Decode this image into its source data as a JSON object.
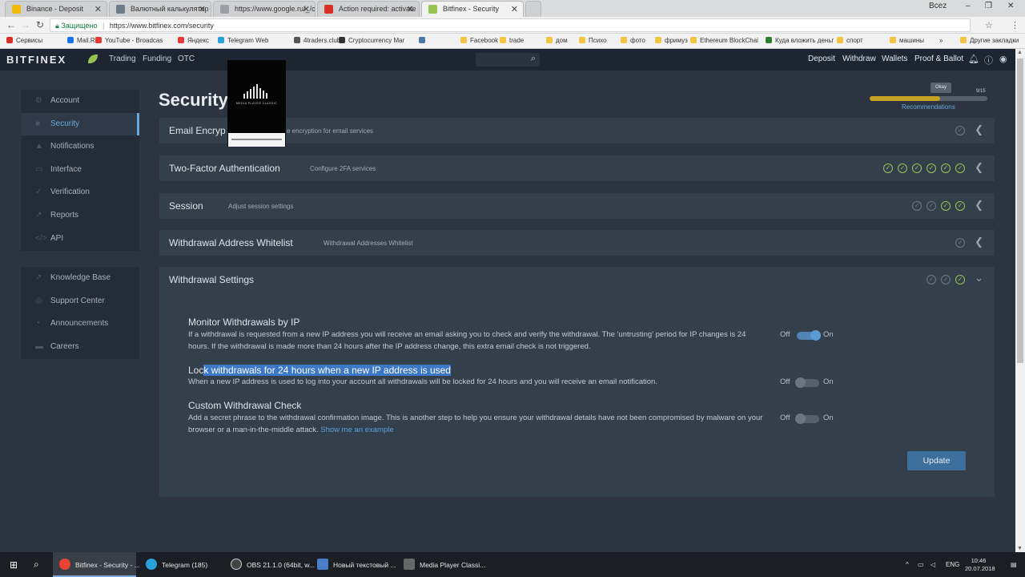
{
  "browser": {
    "tabs": [
      {
        "title": "Binance - Deposit",
        "color": "#f0b90b"
      },
      {
        "title": "Валютный калькулятор",
        "color": "#6d7b8a"
      },
      {
        "title": "https://www.google.ru/_/chro",
        "color": "#9aa0a6"
      },
      {
        "title": "Action required: activate",
        "color": "#d93025"
      },
      {
        "title": "Bitfinex - Security",
        "color": "#97c554"
      }
    ],
    "user_badge": "Всеz",
    "minimize": "–",
    "restore": "❐",
    "close": "✕",
    "secure_label": "Защищено",
    "url": "https://www.bitfinex.com/security",
    "bookmarks": [
      {
        "label": "Сервисы",
        "color": "#d93025"
      },
      {
        "label": "Mail.Ru",
        "color": "#1a73e8"
      },
      {
        "label": "YouTube - Broadcas",
        "color": "#e53935"
      },
      {
        "label": "Яндекс",
        "color": "#e53935"
      },
      {
        "label": "Telegram Web",
        "color": "#2aa1da"
      },
      {
        "label": "4traders.club",
        "color": "#555555"
      },
      {
        "label": "Cryptocurrency Mar",
        "color": "#333333"
      },
      {
        "label": "",
        "color": "#4a76a8"
      },
      {
        "label": "Facebook",
        "color": "#f4c542"
      },
      {
        "label": "trade",
        "color": "#f4c542"
      },
      {
        "label": "дом",
        "color": "#f4c542"
      },
      {
        "label": "Психо",
        "color": "#f4c542"
      },
      {
        "label": "фото",
        "color": "#f4c542"
      },
      {
        "label": "фримуз",
        "color": "#f4c542"
      },
      {
        "label": "Ethereum BlockChai",
        "color": "#f4c542"
      },
      {
        "label": "Куда вложить деньг",
        "color": "#2e7d32"
      },
      {
        "label": "спорт",
        "color": "#f4c542"
      },
      {
        "label": "машины",
        "color": "#f4c542"
      },
      {
        "label": "»",
        "color": ""
      },
      {
        "label": "Другие закладки",
        "color": "#f4c542"
      }
    ]
  },
  "header": {
    "logo": "BITFINEX",
    "nav": [
      "Trading",
      "Funding",
      "OTC"
    ],
    "right": [
      "Deposit",
      "Withdraw",
      "Wallets",
      "Proof & Ballot"
    ]
  },
  "sidebar": {
    "main": [
      {
        "label": "Account",
        "icon": "gear-icon"
      },
      {
        "label": "Security",
        "icon": "lock-icon"
      },
      {
        "label": "Notifications",
        "icon": "bell-icon"
      },
      {
        "label": "Interface",
        "icon": "monitor-icon"
      },
      {
        "label": "Verification",
        "icon": "check-circle-icon"
      },
      {
        "label": "Reports",
        "icon": "chart-icon"
      },
      {
        "label": "API",
        "icon": "code-icon"
      }
    ],
    "help": [
      {
        "label": "Knowledge Base",
        "icon": "external-link-icon"
      },
      {
        "label": "Support Center",
        "icon": "lifebuoy-icon"
      },
      {
        "label": "Announcements",
        "icon": "rss-icon"
      },
      {
        "label": "Careers",
        "icon": "briefcase-icon"
      }
    ]
  },
  "page": {
    "title": "Security",
    "recommendations": {
      "okay": "Okay",
      "count": "9/15",
      "label": "Recommendations",
      "progress": 0.6,
      "color": "#c6a224"
    }
  },
  "panels": [
    {
      "title": "Email Encryp",
      "sub": "e encryption for email services",
      "checks": [
        false
      ]
    },
    {
      "title": "Two-Factor Authentication",
      "sub": "Configure 2FA services",
      "checks": [
        true,
        true,
        true,
        true,
        true,
        true
      ]
    },
    {
      "title": "Session",
      "sub": "Adjust session settings",
      "checks": [
        false,
        false,
        true,
        true
      ]
    },
    {
      "title": "Withdrawal Address Whitelist",
      "sub": "Withdrawal Addresses Whitelist",
      "checks": [
        false
      ]
    },
    {
      "title": "Withdrawal Settings",
      "sub": "",
      "checks": [
        false,
        false,
        true
      ]
    }
  ],
  "withdrawal_settings": {
    "monitor": {
      "title": "Monitor Withdrawals by IP",
      "desc": "If a withdrawal is requested from a new IP address you will receive an email asking you to check and verify the withdrawal. The 'untrusting' period for IP changes is 24 hours. If the withdrawal is made more than 24 hours after the IP address change, this extra email check is not triggered.",
      "state": "on"
    },
    "lock": {
      "title_pre": "Loc",
      "title_hl": "k withdrawals for 24 hours when a new IP address is used",
      "desc": "When a new IP address is used to log into your account all withdrawals will be locked for 24 hours and you will receive an email notification.",
      "state": "off"
    },
    "custom": {
      "title": "Custom Withdrawal Check",
      "desc": "Add a secret phrase to the withdrawal confirmation image. This is another step to help you ensure your withdrawal details have not been compromised by malware on your browser or a man-in-the-middle attack.",
      "link": "Show me an example"
    },
    "off_label": "Off",
    "on_label": "On",
    "update": "Update"
  },
  "media_player": {
    "text": "MEDIA PLAYER CLASSIC"
  },
  "taskbar": {
    "items": [
      {
        "label": "Bitfinex - Security - ...",
        "color": "#ea4335"
      },
      {
        "label": "Telegram (185)",
        "color": "#2aa1da"
      },
      {
        "label": "OBS 21.1.0 (64bit, w...",
        "color": "#444444"
      },
      {
        "label": "Новый текстовый ...",
        "color": "#4a7cc7"
      },
      {
        "label": "Media Player Classi...",
        "color": "#444444"
      }
    ],
    "lang": "ENG",
    "time": "10:46",
    "date": "20.07.2018"
  }
}
